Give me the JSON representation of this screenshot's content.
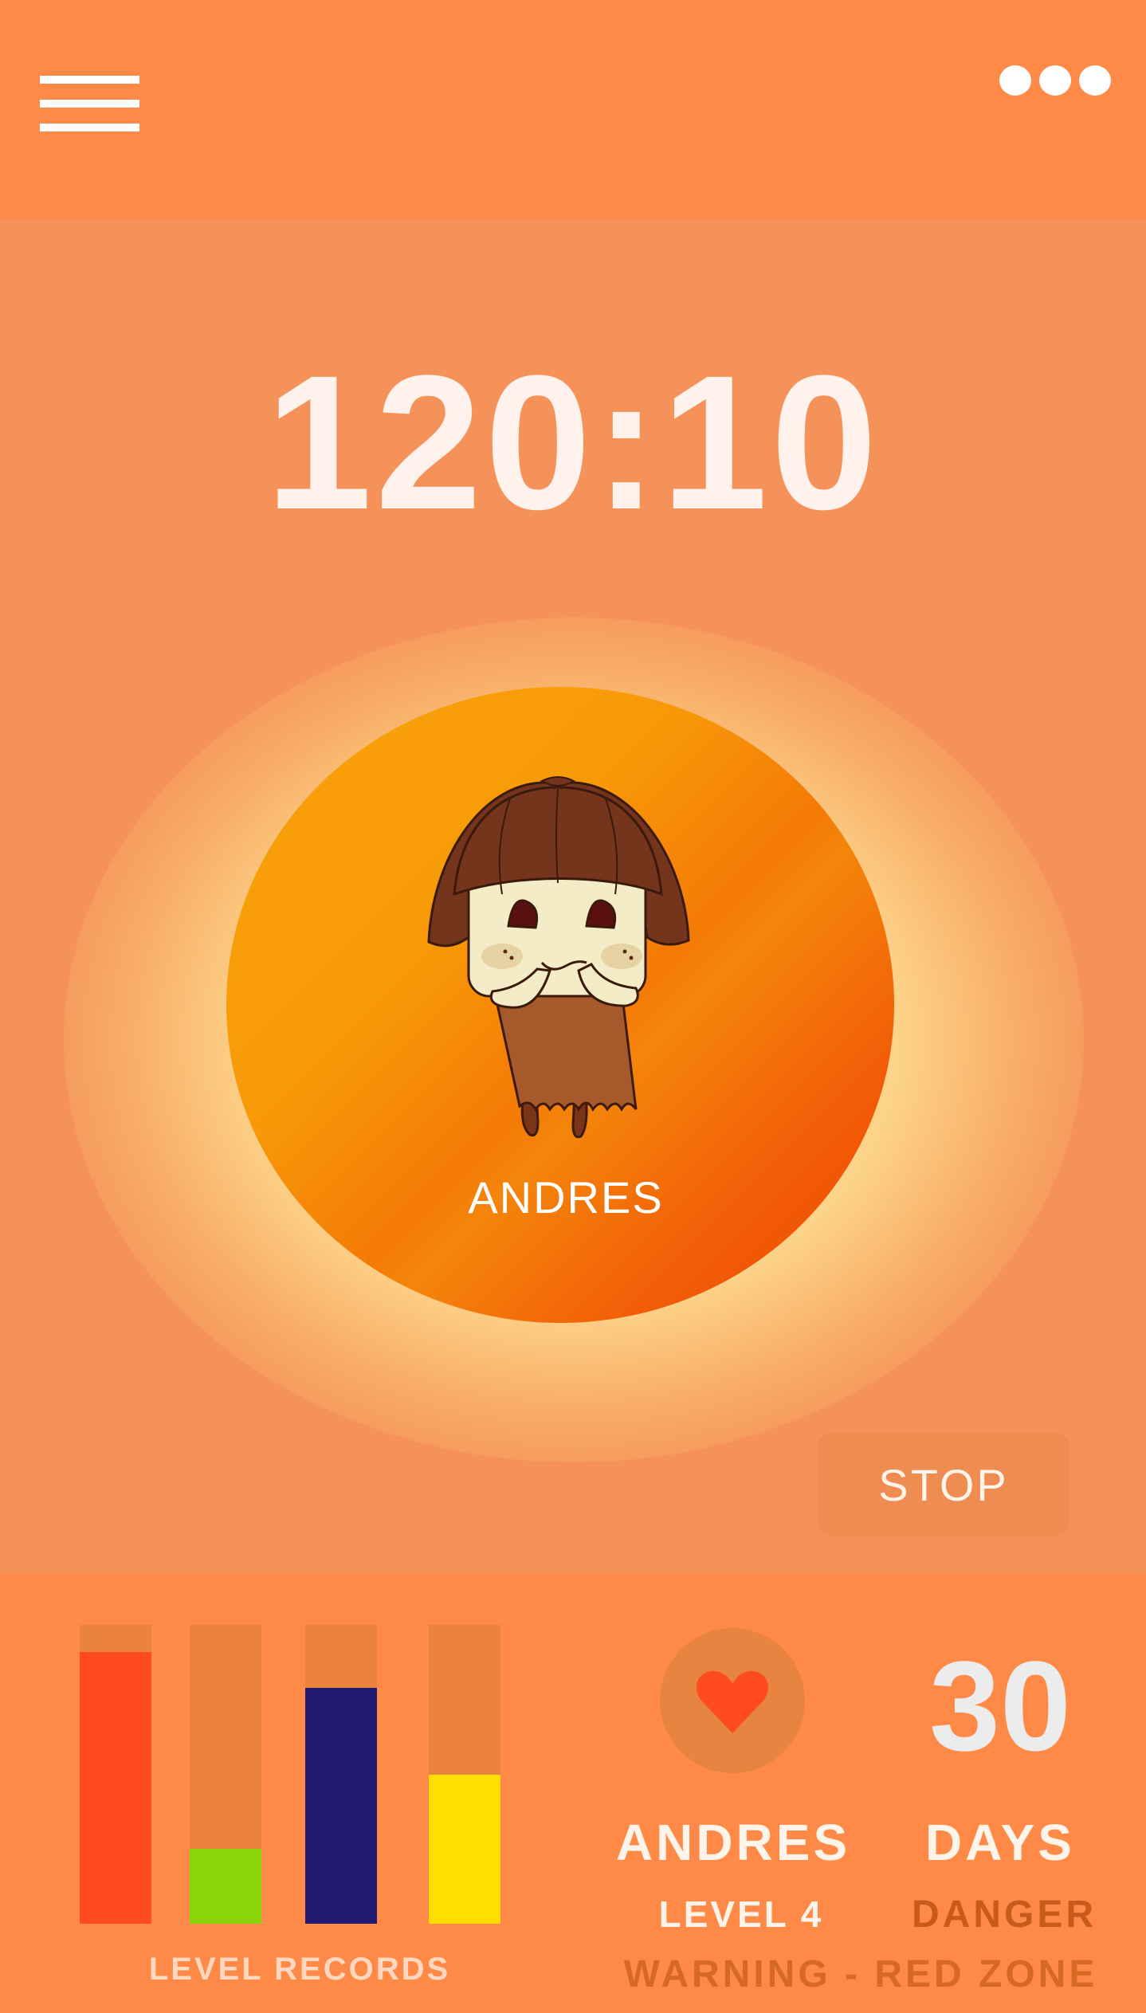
{
  "header": {
    "menu_icon": "hamburger-menu-icon",
    "more_icon": "more-options-icon"
  },
  "timer": {
    "value": "120:10"
  },
  "player": {
    "name": "ANDRES",
    "avatar_icon": "character-avatar"
  },
  "controls": {
    "stop_label": "STOP"
  },
  "level_records": {
    "label": "LEVEL RECORDS",
    "bars": [
      {
        "fill_fraction": 0.91,
        "color": "#ff4b1f"
      },
      {
        "fill_fraction": 0.25,
        "color": "#8bd40a"
      },
      {
        "fill_fraction": 0.79,
        "color": "#231a73"
      },
      {
        "fill_fraction": 0.5,
        "color": "#ffde00"
      }
    ],
    "track_color": "#e9833e"
  },
  "stats": {
    "heart_icon": "heart-icon",
    "heart_color": "#ff4b1f",
    "days_value": "30",
    "name": "ANDRES",
    "days_label": "DAYS",
    "level": "LEVEL 4",
    "status": "DANGER",
    "warning": "WARNING - RED ZONE"
  },
  "colors": {
    "header_bg": "#ff8a47",
    "main_bg": "#f5925a",
    "circle_orange": "#f7a20a",
    "danger_text": "#c85a1c"
  }
}
